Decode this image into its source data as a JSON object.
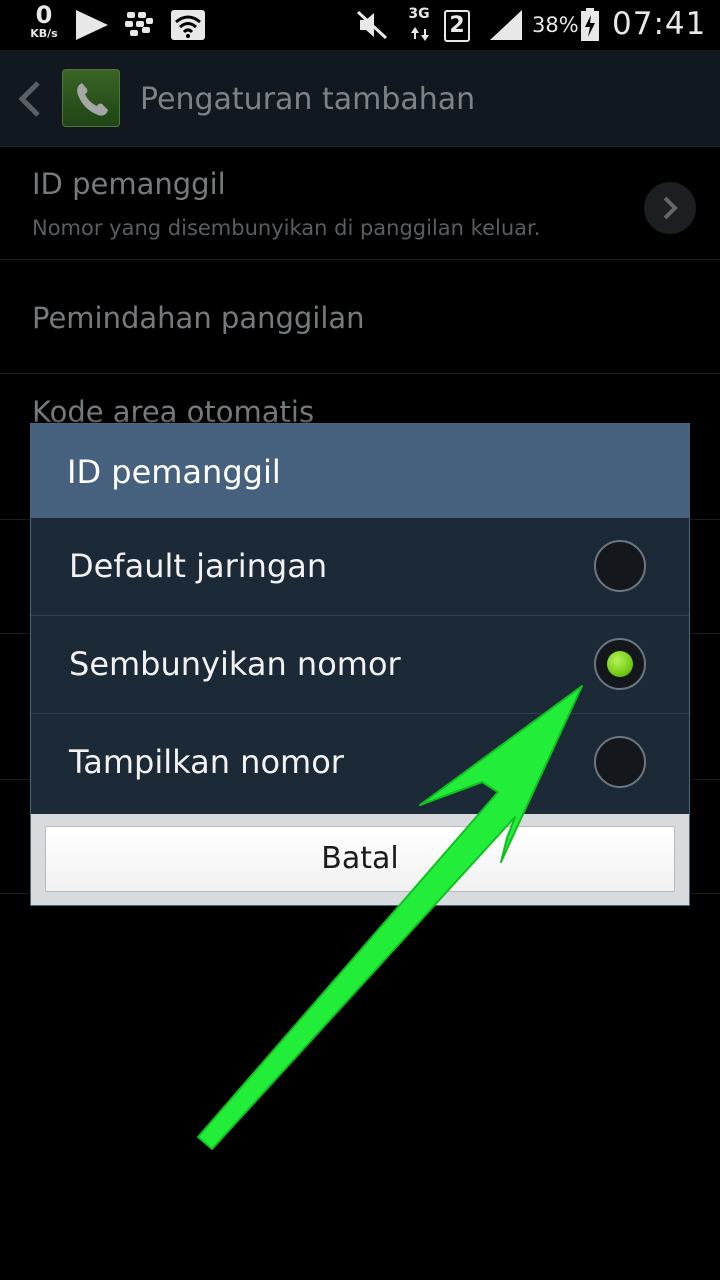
{
  "status_bar": {
    "net_speed": "0",
    "net_speed_unit": "KB/s",
    "network_type": "3G",
    "sim_slot": "2",
    "battery_percent": "38%",
    "time": "07:41",
    "icons": [
      "play-store-icon",
      "bbm-icon",
      "wifi-icon",
      "mute-icon",
      "signal-icon",
      "battery-charging-icon"
    ]
  },
  "action_bar": {
    "title": "Pengaturan tambahan",
    "app_icon": "phone-icon"
  },
  "settings": {
    "items": [
      {
        "title": "ID pemanggil",
        "subtitle": "Nomor yang disembunyikan di panggilan keluar."
      },
      {
        "title": "Pemindahan panggilan"
      },
      {
        "title": "Kode area otomatis"
      }
    ]
  },
  "dialog": {
    "title": "ID pemanggil",
    "options": [
      {
        "label": "Default jaringan",
        "selected": false
      },
      {
        "label": "Sembunyikan nomor",
        "selected": true
      },
      {
        "label": "Tampilkan nomor",
        "selected": false
      }
    ],
    "cancel_label": "Batal"
  },
  "colors": {
    "action_bar": "#1c2530",
    "dialog_header": "#46617d",
    "dialog_body": "#1c2a38",
    "radio_selected": "#7ad11a",
    "annotation_arrow": "#22ee3a"
  }
}
